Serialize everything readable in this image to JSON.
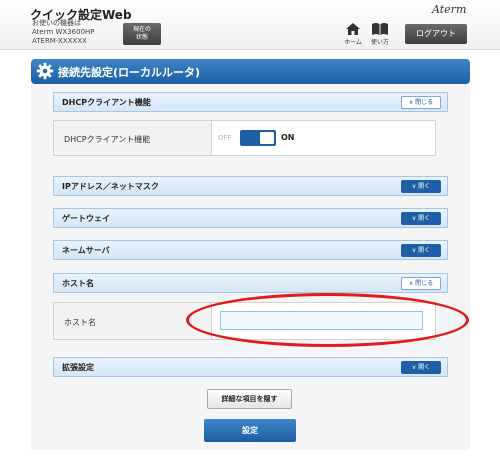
{
  "header": {
    "app_title": "クイック設定Web",
    "device_lines": [
      "お使いの機器は",
      "Aterm WX3600HP",
      "ATERM-XXXXXX"
    ],
    "status_button": [
      "現在の",
      "状態"
    ],
    "brand": "Aterm",
    "home_label": "ホーム",
    "manual_label": "使い方",
    "logout_label": "ログアウト"
  },
  "page": {
    "title": "接続先設定(ローカルルータ)"
  },
  "sections": [
    {
      "title": "DHCPクライアント機能",
      "toggle": "閉じる",
      "state": "expanded"
    },
    {
      "title": "IPアドレス／ネットマスク",
      "toggle": "開く",
      "state": "collapsed"
    },
    {
      "title": "ゲートウェイ",
      "toggle": "開く",
      "state": "collapsed"
    },
    {
      "title": "ネームサーバ",
      "toggle": "開く",
      "state": "collapsed"
    },
    {
      "title": "ホスト名",
      "toggle": "閉じる",
      "state": "expanded"
    },
    {
      "title": "拡張設定",
      "toggle": "開く",
      "state": "collapsed"
    }
  ],
  "dhcp": {
    "label": "DHCPクライアント機能",
    "off_label": "OFF",
    "on_label": "ON",
    "value": "ON"
  },
  "hostname": {
    "label": "ホスト名",
    "value": ""
  },
  "actions": {
    "hide_details": "詳細な項目を隠す",
    "submit": "設定"
  },
  "colors": {
    "accent": "#1f5fa6",
    "highlight": "#e21b1b"
  }
}
